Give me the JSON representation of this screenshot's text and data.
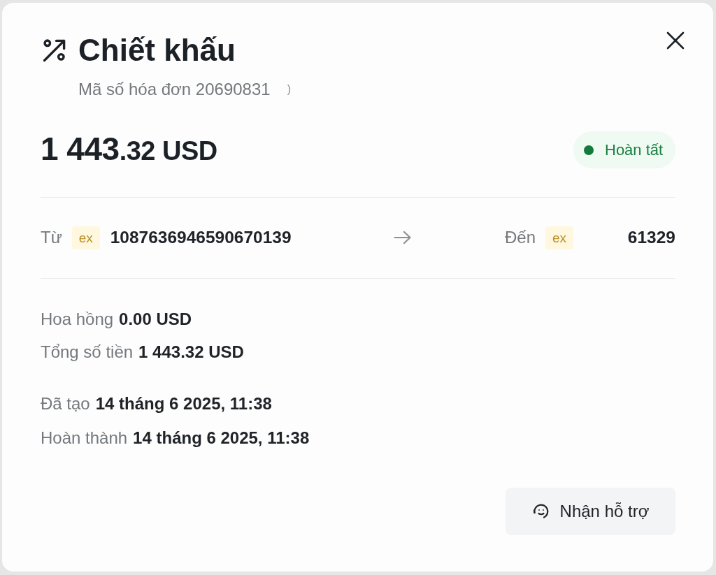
{
  "dialog": {
    "title": "Chiết khấu",
    "subtitle": "Mã số hóa đơn 20690831",
    "subtitle_fragment": ")"
  },
  "amount": {
    "integer": "1 443",
    "decimal": ".32",
    "currency": "USD"
  },
  "status": {
    "label": "Hoàn tất"
  },
  "transfer": {
    "from": {
      "label": "Từ",
      "badge": "ex",
      "account": "1087636946590670139"
    },
    "to": {
      "label": "Đến",
      "badge": "ex",
      "account": "61329"
    }
  },
  "totals": [
    {
      "label": "Hoa hồng",
      "value": "0.00 USD"
    },
    {
      "label": "Tổng số tiền",
      "value": "1 443.32 USD"
    }
  ],
  "dates": [
    {
      "label": "Đã tạo",
      "value": "14 tháng 6 2025, 11:38"
    },
    {
      "label": "Hoàn thành",
      "value": "14 tháng 6 2025, 11:38"
    }
  ],
  "support_button": {
    "label": "Nhận hỗ trợ"
  }
}
